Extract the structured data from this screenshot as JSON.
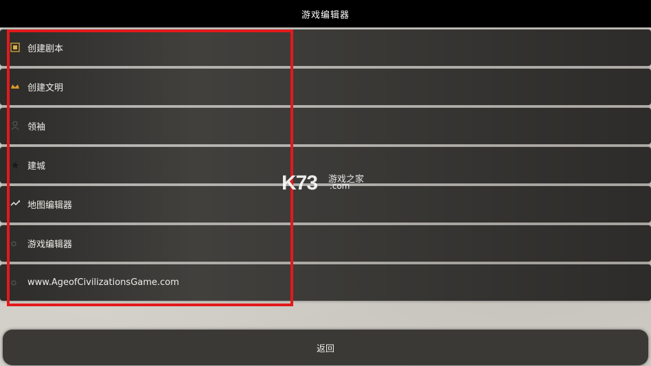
{
  "header": {
    "title": "游戏编辑器"
  },
  "menu": {
    "items": [
      {
        "label": "创建剧本",
        "icon": "scenario-icon"
      },
      {
        "label": "创建文明",
        "icon": "crown-icon"
      },
      {
        "label": "领袖",
        "icon": "leader-icon"
      },
      {
        "label": "建城",
        "icon": "star-icon"
      },
      {
        "label": "地图编辑器",
        "icon": "map-icon"
      },
      {
        "label": "游戏编辑器",
        "icon": "circle-icon"
      },
      {
        "label": "www.AgeofCivilizationsGame.com",
        "icon": "circle-icon"
      }
    ]
  },
  "footer": {
    "back_label": "返回"
  },
  "watermark": {
    "main": "K73",
    "cn": "游戏之家",
    "sub": ".com"
  },
  "colors": {
    "highlight": "#e21a1a",
    "row_bg": "#3b3a37",
    "title_bg": "#000000"
  }
}
